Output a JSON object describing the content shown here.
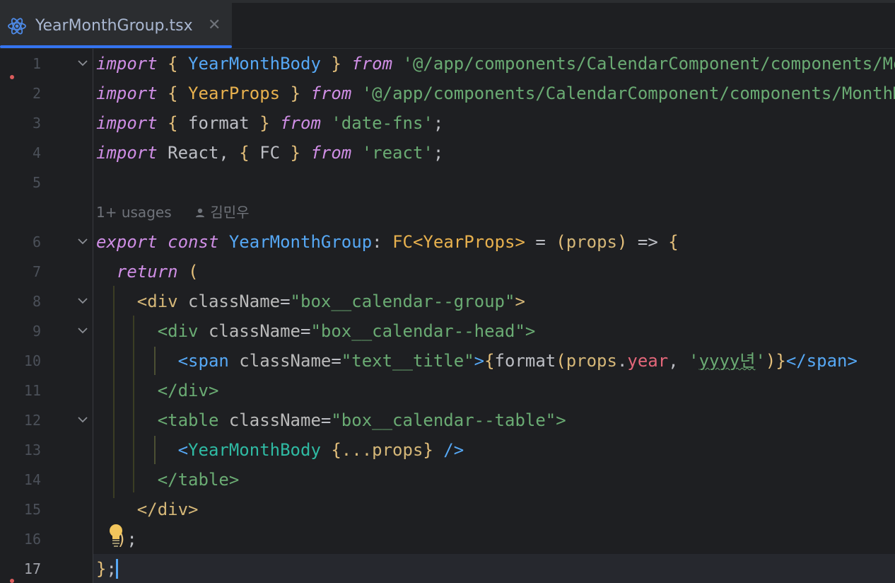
{
  "tab": {
    "label": "YearMonthGroup.tsx",
    "icon": "react-icon",
    "close_icon": "close-icon",
    "close_glyph": "✕"
  },
  "colors": {
    "background": "#1e1f22",
    "tab_active_underline": "#3574f0",
    "keyword": "#cf8ee5",
    "string": "#6aab73",
    "tag": "#d5b778"
  },
  "inlay_hint": {
    "usages": "1+ usages",
    "author_icon": "person-icon",
    "author": "김민우"
  },
  "lines": [
    {
      "number": "1",
      "text": "import { YearMonthBody } from '@/app/components/CalendarComponent/components/Mo"
    },
    {
      "number": "2",
      "text": "import { YearProps } from '@/app/components/CalendarComponent/components/MonthM"
    },
    {
      "number": "3",
      "text": "import { format } from 'date-fns';"
    },
    {
      "number": "4",
      "text": "import React, { FC } from 'react';"
    },
    {
      "number": "5",
      "text": ""
    },
    {
      "number": "6",
      "text": "export const YearMonthGroup: FC<YearProps> = (props) => {"
    },
    {
      "number": "7",
      "text": "  return ("
    },
    {
      "number": "8",
      "text": "    <div className=\"box__calendar--group\">"
    },
    {
      "number": "9",
      "text": "      <div className=\"box__calendar--head\">"
    },
    {
      "number": "10",
      "text": "        <span className=\"text__title\">{format(props.year, 'yyyy년')}</span>"
    },
    {
      "number": "11",
      "text": "      </div>"
    },
    {
      "number": "12",
      "text": "      <table className=\"box__calendar--table\">"
    },
    {
      "number": "13",
      "text": "        <YearMonthBody {...props} />"
    },
    {
      "number": "14",
      "text": "      </table>"
    },
    {
      "number": "15",
      "text": "    </div>"
    },
    {
      "number": "16",
      "text": "  );"
    },
    {
      "number": "17",
      "text": "};"
    }
  ],
  "tokens": {
    "l1": [
      "import",
      " ",
      "{",
      " YearMonthBody ",
      "}",
      " ",
      "from",
      " ",
      "'@/app/components/CalendarComponent/components/Mo"
    ],
    "l2": [
      "import",
      " ",
      "{",
      " YearProps ",
      "}",
      " ",
      "from",
      " ",
      "'@/app/components/CalendarComponent/components/MonthM"
    ],
    "l3": [
      "import",
      " ",
      "{",
      " format ",
      "}",
      " ",
      "from",
      " ",
      "'date-fns'",
      ";"
    ],
    "l4": [
      "import",
      " React, ",
      "{",
      " FC ",
      "}",
      " ",
      "from",
      " ",
      "'react'",
      ";"
    ],
    "l6": [
      "export",
      " ",
      "const",
      " ",
      "YearMonthGroup",
      ": ",
      "FC",
      "<",
      "YearProps",
      ">",
      " = ",
      "(",
      "props",
      ")",
      " => ",
      "{"
    ],
    "l7": [
      "  ",
      "return",
      " ",
      "("
    ],
    "l8": [
      "    ",
      "<div",
      " ",
      "className",
      "=",
      "\"box__calendar--group\"",
      ">"
    ],
    "l9": [
      "      ",
      "<div",
      " ",
      "className",
      "=",
      "\"box__calendar--head\"",
      ">"
    ],
    "l10": [
      "        ",
      "<span",
      " ",
      "className",
      "=",
      "\"text__title\"",
      ">",
      "{",
      "format",
      "(",
      "props",
      ".",
      "year",
      ", ",
      "'",
      "yyyy년",
      "'",
      ")",
      "}",
      "</span",
      ">"
    ],
    "l11": [
      "      ",
      "</div>"
    ],
    "l12": [
      "      ",
      "<table",
      " ",
      "className",
      "=",
      "\"box__calendar--table\"",
      ">"
    ],
    "l13": [
      "        ",
      "<",
      "YearMonthBody",
      " ",
      "{",
      "...props",
      "}",
      " ",
      "/>"
    ],
    "l14": [
      "      ",
      "</table>"
    ],
    "l15": [
      "    ",
      "</div>"
    ],
    "l16": [
      "  ",
      ")",
      ";"
    ],
    "l17": [
      "}",
      ";"
    ]
  }
}
